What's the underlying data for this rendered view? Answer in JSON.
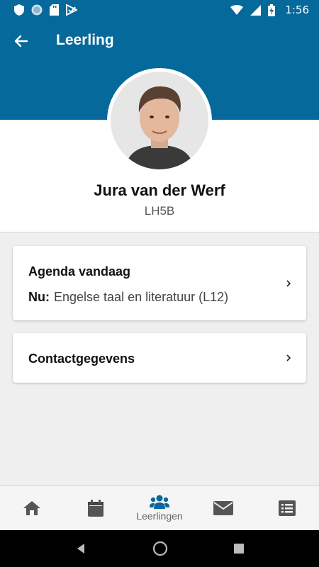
{
  "status_bar": {
    "time": "1:56",
    "icons": [
      "shield-icon",
      "globe-icon",
      "sd-card-icon",
      "check-play-icon",
      "wifi-icon",
      "signal-icon",
      "battery-charging-icon"
    ]
  },
  "app_bar": {
    "title": "Leerling",
    "back_icon": "arrow-left-icon"
  },
  "profile": {
    "name": "Jura van der Werf",
    "class": "LH5B"
  },
  "cards": {
    "agenda": {
      "title": "Agenda vandaag",
      "now_label": "Nu:",
      "now_value": "Engelse taal en literatuur (L12)"
    },
    "contact": {
      "title": "Contactgegevens"
    }
  },
  "bottom_nav": {
    "items": [
      {
        "icon": "home-icon",
        "label": ""
      },
      {
        "icon": "calendar-icon",
        "label": ""
      },
      {
        "icon": "users-icon",
        "label": "Leerlingen",
        "active": true
      },
      {
        "icon": "envelope-icon",
        "label": ""
      },
      {
        "icon": "list-icon",
        "label": ""
      }
    ]
  },
  "colors": {
    "primary": "#06699b",
    "nav_active": "#06699b",
    "nav_inactive": "#555555"
  }
}
